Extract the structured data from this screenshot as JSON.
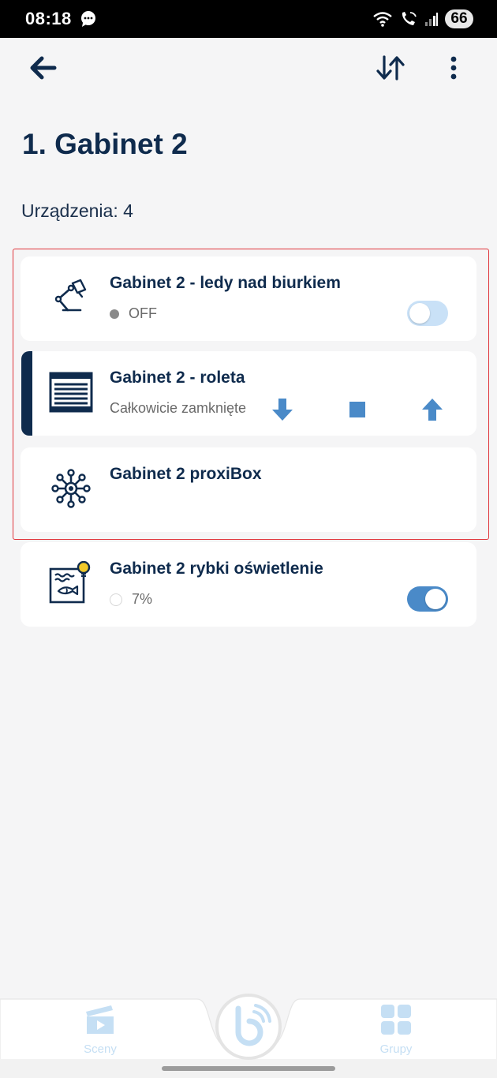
{
  "status_bar": {
    "time": "08:18",
    "battery": "66"
  },
  "appbar": {
    "back_icon": "arrow-left-icon",
    "sort_icon": "sort-icon",
    "more_icon": "more-vertical-icon"
  },
  "page": {
    "title": "1. Gabinet 2",
    "count_label": "Urządzenia:",
    "count_value": "4"
  },
  "devices": [
    {
      "name": "Gabinet 2 - ledy nad biurkiem",
      "status": "OFF",
      "icon": "desk-lamp-icon",
      "toggle_on": false
    },
    {
      "name": "Gabinet 2 - roleta",
      "status": "Całkowicie zamknięte",
      "icon": "roller-blind-icon"
    },
    {
      "name": "Gabinet 2 proxiBox",
      "icon": "hub-network-icon"
    },
    {
      "name": "Gabinet 2 rybki oświetlenie",
      "status": "7%",
      "icon": "aquarium-light-icon",
      "toggle_on": true
    }
  ],
  "bottom_nav": {
    "scenes_label": "Sceny",
    "groups_label": "Grupy"
  },
  "colors": {
    "primary_dark": "#0f2b4d",
    "accent_blue": "#4a8ac8",
    "light_blue": "#c9e1f7",
    "highlight_red": "#e0353b",
    "background": "#f5f5f6"
  }
}
